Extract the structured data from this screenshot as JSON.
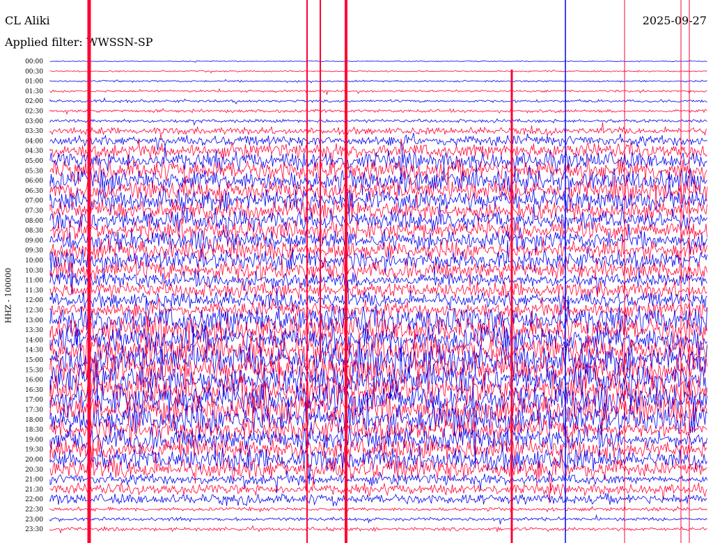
{
  "header": {
    "station": "CL Aliki",
    "date": "2025-09-27",
    "filter": "Applied filter: WWSSN-SP"
  },
  "chart_data": {
    "type": "line",
    "title": "CL Aliki",
    "ylabel": "HHZ - 100000",
    "time_labels": [
      "00:00",
      "00:30",
      "01:00",
      "01:30",
      "02:00",
      "02:30",
      "03:00",
      "03:30",
      "04:00",
      "04:30",
      "05:00",
      "05:30",
      "06:00",
      "06:30",
      "07:00",
      "07:30",
      "08:00",
      "08:30",
      "09:00",
      "09:30",
      "10:00",
      "10:30",
      "11:00",
      "11:30",
      "12:00",
      "12:30",
      "13:00",
      "13:30",
      "14:00",
      "14:30",
      "15:00",
      "15:30",
      "16:00",
      "16:30",
      "17:00",
      "17:30",
      "18:00",
      "18:30",
      "19:00",
      "19:30",
      "20:00",
      "20:30",
      "21:00",
      "21:30",
      "22:00",
      "22:30",
      "23:00",
      "23:30"
    ],
    "colors": {
      "odd_trace": "#0000ee",
      "even_trace": "#ff0033",
      "text": "#000000"
    },
    "grid": false
  }
}
